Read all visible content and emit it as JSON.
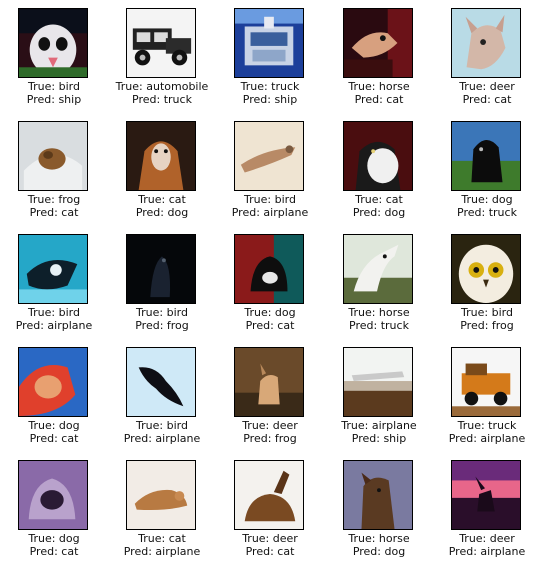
{
  "samples": [
    {
      "true_label": "True: bird",
      "pred_label": "Pred: ship",
      "thumb": "bird-face"
    },
    {
      "true_label": "True: automobile",
      "pred_label": "Pred: truck",
      "thumb": "old-car"
    },
    {
      "true_label": "True: truck",
      "pred_label": "Pred: ship",
      "thumb": "truck-front"
    },
    {
      "true_label": "True: horse",
      "pred_label": "Pred: cat",
      "thumb": "horse-head"
    },
    {
      "true_label": "True: deer",
      "pred_label": "Pred: cat",
      "thumb": "deer-head"
    },
    {
      "true_label": "True: frog",
      "pred_label": "Pred: cat",
      "thumb": "frog"
    },
    {
      "true_label": "True: cat",
      "pred_label": "Pred: dog",
      "thumb": "cat-sitting"
    },
    {
      "true_label": "True: bird",
      "pred_label": "Pred: airplane",
      "thumb": "bird-flying"
    },
    {
      "true_label": "True: cat",
      "pred_label": "Pred: dog",
      "thumb": "cat-black-white"
    },
    {
      "true_label": "True: dog",
      "pred_label": "Pred: truck",
      "thumb": "dog-black"
    },
    {
      "true_label": "True: bird",
      "pred_label": "Pred: airplane",
      "thumb": "bird-cyan"
    },
    {
      "true_label": "True: bird",
      "pred_label": "Pred: frog",
      "thumb": "bird-dark"
    },
    {
      "true_label": "True: dog",
      "pred_label": "Pred: cat",
      "thumb": "dog-dark"
    },
    {
      "true_label": "True: horse",
      "pred_label": "Pred: truck",
      "thumb": "horse-white"
    },
    {
      "true_label": "True: bird",
      "pred_label": "Pred: frog",
      "thumb": "owl"
    },
    {
      "true_label": "True: dog",
      "pred_label": "Pred: cat",
      "thumb": "dog-red"
    },
    {
      "true_label": "True: bird",
      "pred_label": "Pred: airplane",
      "thumb": "bird-silhouette"
    },
    {
      "true_label": "True: deer",
      "pred_label": "Pred: frog",
      "thumb": "deer-field"
    },
    {
      "true_label": "True: airplane",
      "pred_label": "Pred: ship",
      "thumb": "airplane-landscape"
    },
    {
      "true_label": "True: truck",
      "pred_label": "Pred: airplane",
      "thumb": "truck-toy"
    },
    {
      "true_label": "True: dog",
      "pred_label": "Pred: cat",
      "thumb": "dog-purple"
    },
    {
      "true_label": "True: cat",
      "pred_label": "Pred: airplane",
      "thumb": "cat-lying"
    },
    {
      "true_label": "True: deer",
      "pred_label": "Pred: cat",
      "thumb": "deer-sitting"
    },
    {
      "true_label": "True: horse",
      "pred_label": "Pred: dog",
      "thumb": "horse-brown"
    },
    {
      "true_label": "True: deer",
      "pred_label": "Pred: airplane",
      "thumb": "deer-sunset"
    }
  ]
}
